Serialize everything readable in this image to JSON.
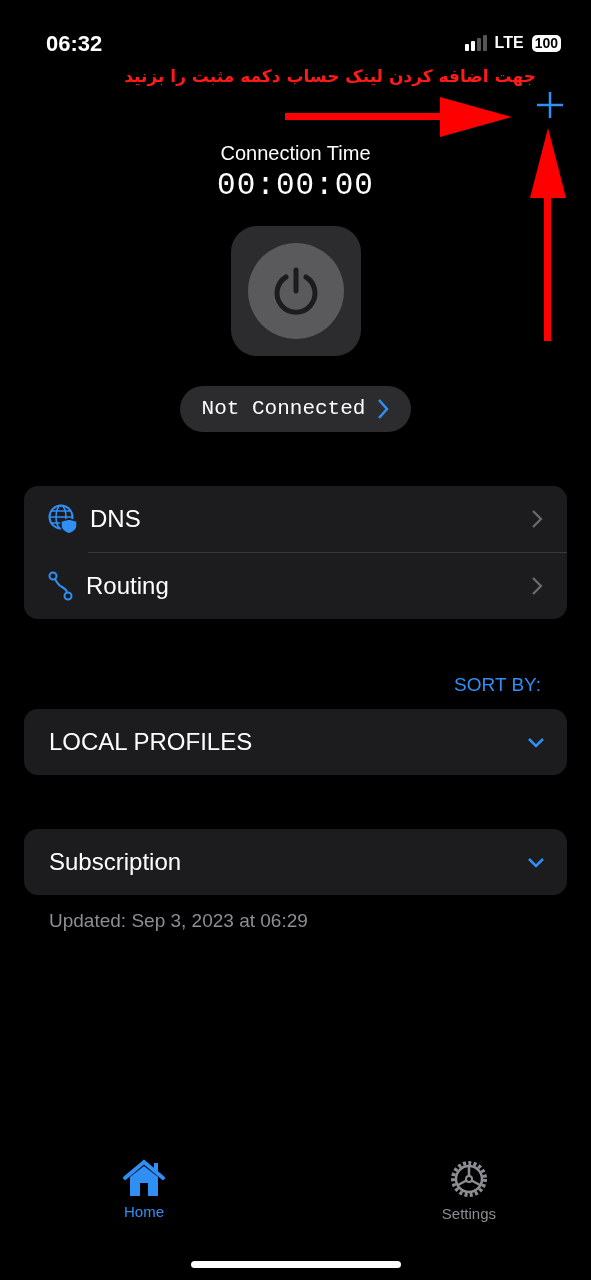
{
  "status_bar": {
    "time": "06:32",
    "network": "LTE",
    "battery": "100"
  },
  "annotation": {
    "text": "جهت اضافه کردن لینک حساب دکمه مثبت را بزنید"
  },
  "connection": {
    "title": "Connection Time",
    "timer": "00:00:00",
    "status": "Not Connected",
    "connected": false
  },
  "settings_list": [
    {
      "kind": "dns",
      "label": "DNS"
    },
    {
      "kind": "routing",
      "label": "Routing"
    }
  ],
  "sort_label": "SORT BY:",
  "profile_groups": [
    {
      "title": "LOCAL PROFILES",
      "expanded": false
    },
    {
      "title": "Subscription",
      "expanded": false,
      "updated": "Updated: Sep 3, 2023 at 06:29"
    }
  ],
  "tabs": [
    {
      "kind": "home",
      "label": "Home",
      "selected": true
    },
    {
      "kind": "settings",
      "label": "Settings",
      "selected": false
    }
  ]
}
